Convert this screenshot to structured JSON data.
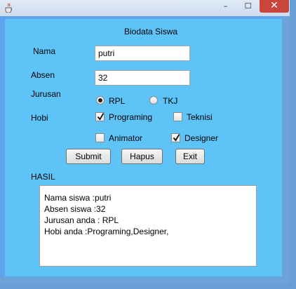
{
  "window": {
    "title": "",
    "minimize": "–",
    "maximize": "☐",
    "close": "✕"
  },
  "form": {
    "heading": "Biodata Siswa",
    "nama_label": "Nama",
    "nama_value": "putri",
    "absen_label": "Absen",
    "absen_value": "32",
    "jurusan_label": "Jurusan",
    "jurusan_options": [
      {
        "label": "RPL",
        "selected": true
      },
      {
        "label": "TKJ",
        "selected": false
      }
    ],
    "hobi_label": "Hobi",
    "hobi_options": [
      {
        "label": "Programing",
        "checked": true
      },
      {
        "label": "Teknisi",
        "checked": false
      },
      {
        "label": "Animator",
        "checked": false
      },
      {
        "label": "Designer",
        "checked": true
      }
    ]
  },
  "buttons": {
    "submit": "Submit",
    "hapus": "Hapus",
    "exit": "Exit"
  },
  "hasil": {
    "label": "HASIL",
    "lines": [
      "Nama siswa :putri",
      "Absen siswa :32",
      "Jurusan anda : RPL",
      "Hobi anda :Programing,Designer,"
    ]
  },
  "colors": {
    "panel": "#5ec3f7",
    "frame": "#5fa3ec",
    "close": "#c9463d"
  },
  "icons": {
    "app": "java-cup-icon"
  }
}
